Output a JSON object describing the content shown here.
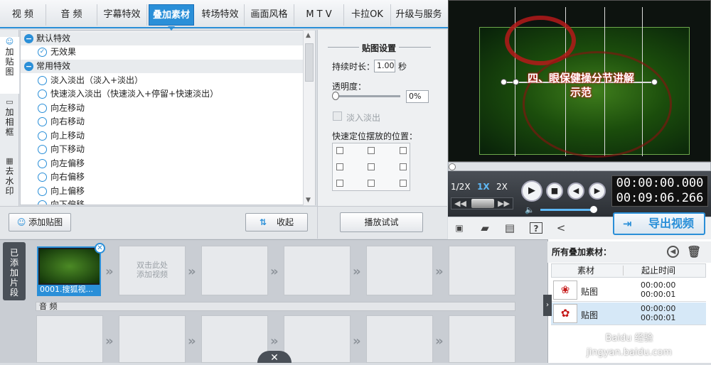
{
  "tabs": [
    "视 频",
    "音 频",
    "字幕特效",
    "叠加素材",
    "转场特效",
    "画面风格",
    "M T V",
    "卡拉OK",
    "升级与服务"
  ],
  "active_tab": "叠加素材",
  "sidenav": [
    {
      "icon": "add-sticker-icon",
      "label": "加\n贴\n图"
    },
    {
      "icon": "add-frame-icon",
      "label": "加\n相\n框"
    },
    {
      "icon": "remove-watermark-icon",
      "label": "去\n水\n印"
    }
  ],
  "effects": {
    "groups": [
      {
        "name": "默认特效",
        "items": [
          "无效果"
        ]
      },
      {
        "name": "常用特效",
        "items": [
          "淡入淡出（淡入+淡出）",
          "快速淡入淡出（快速淡入+停留+快速淡出）",
          "向左移动",
          "向右移动",
          "向上移动",
          "向下移动",
          "向左偏移",
          "向右偏移",
          "向上偏移",
          "向下偏移"
        ]
      }
    ],
    "selected": "无效果"
  },
  "buttons": {
    "add_sticker": "添加贴图",
    "collapse": "收起",
    "preview_test": "播放试试"
  },
  "settings": {
    "title": "贴图设置",
    "duration_label": "持续时长：",
    "duration_value": "1.00",
    "duration_unit": "秒",
    "opacity_label": "透明度：",
    "opacity_value": "0%",
    "fade_label": "淡入淡出",
    "position_label": "快速定位摆放的位置："
  },
  "preview": {
    "overlay_title_line1": "四、眼保健操分节讲解",
    "overlay_title_line2": "示范"
  },
  "playback": {
    "speeds": [
      "1/2X",
      "1X",
      "2X"
    ],
    "active_speed": "1X",
    "current_time": "00:00:00.000",
    "total_time": "00:09:06.266"
  },
  "toolbar_icons": [
    "new-icon",
    "open-folder-icon",
    "save-icon",
    "help-icon",
    "share-icon"
  ],
  "export_label": "导出视频",
  "timeline": {
    "side_label": "已\n添\n加\n片\n段",
    "clip_label": "0001.搜狐视...",
    "placeholder": "双击此处\n添加视频",
    "audio_label": "音 频"
  },
  "overlay_panel": {
    "title": "所有叠加素材：",
    "col_material": "素材",
    "col_time": "起止时间",
    "rows": [
      {
        "name": "贴图",
        "start": "00:00:00",
        "end": "00:00:01"
      },
      {
        "name": "贴图",
        "start": "00:00:00",
        "end": "00:00:01"
      }
    ]
  },
  "watermark": "Baidu 经验\njingyan.baidu.com",
  "colors": {
    "accent": "#2a8fd8",
    "title_red": "#c51818"
  }
}
